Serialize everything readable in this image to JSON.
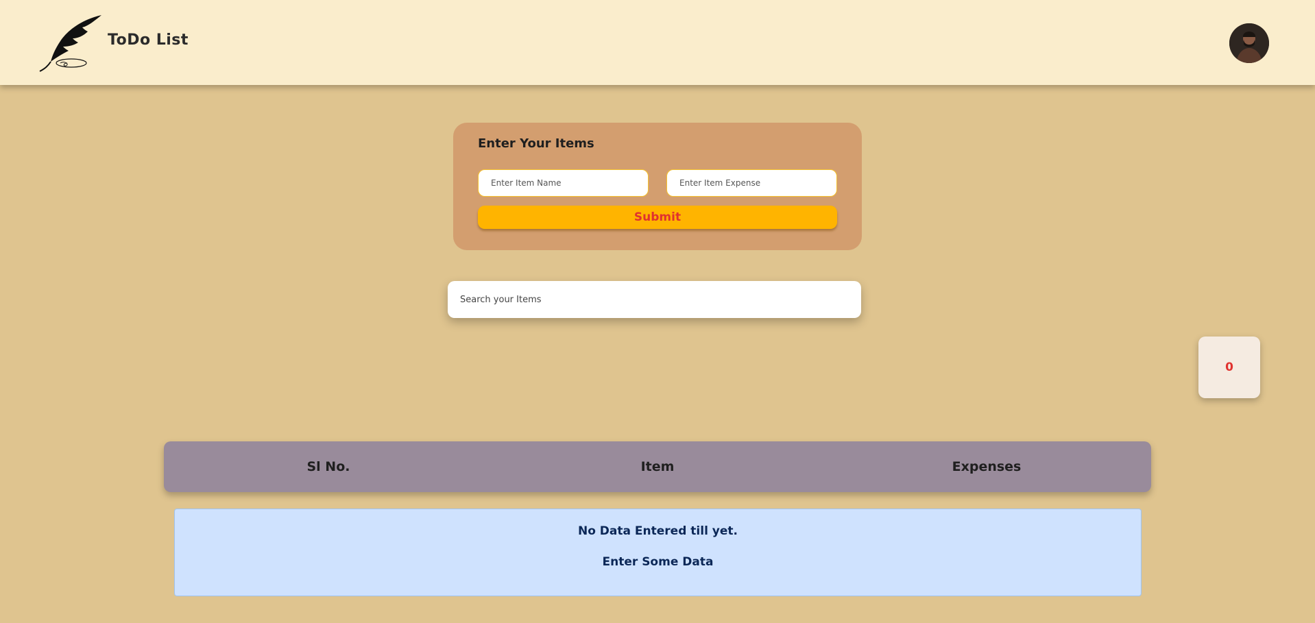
{
  "navbar": {
    "logo_icon": "quill-feather-icon",
    "brand": "ToDo List",
    "avatar_icon": "user-avatar"
  },
  "form": {
    "title": "Enter Your Items",
    "item_name_placeholder": "Enter Item Name",
    "item_expense_placeholder": "Enter Item Expense",
    "submit_label": "Submit"
  },
  "search": {
    "placeholder": "Search your Items"
  },
  "counter": {
    "value": "0"
  },
  "table": {
    "columns": [
      "Sl No.",
      "Item",
      "Expenses"
    ]
  },
  "empty_state": {
    "line1": "No Data Entered till yet.",
    "line2": "Enter Some Data"
  },
  "colors": {
    "page_bg": "#dfc48f",
    "navbar_bg": "#faedcc",
    "form_bg": "#d39e6f",
    "submit_bg": "#ffb400",
    "accent_red": "#e0322f",
    "table_header_bg": "#998b9b",
    "empty_bg": "#cfe2fe"
  }
}
